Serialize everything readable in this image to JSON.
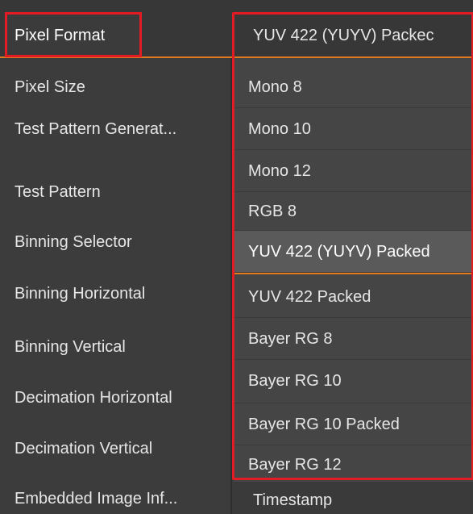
{
  "pixel_format": {
    "label": "Pixel Format",
    "current_value": "YUV 422 (YUYV) Packec"
  },
  "properties": [
    "Pixel Size",
    "Test Pattern Generat...",
    "Test Pattern",
    "Binning Selector",
    "Binning Horizontal",
    "Binning Vertical",
    "Decimation Horizontal",
    "Decimation Vertical",
    "Embedded Image Inf..."
  ],
  "dropdown": {
    "options": [
      "Mono 8",
      "Mono 10",
      "Mono 12",
      "RGB 8",
      "YUV 422 (YUYV) Packed",
      "YUV 422 Packed",
      "Bayer RG 8",
      "Bayer RG 10",
      "Bayer RG 10 Packed",
      "Bayer RG 12"
    ],
    "selected_index": 4
  },
  "embedded_value": "Timestamp",
  "colors": {
    "highlight_red": "#e21b25",
    "accent_orange": "#e07a1f",
    "panel_bg": "#3a3a3a",
    "selected_bg": "#5a5a5a"
  }
}
